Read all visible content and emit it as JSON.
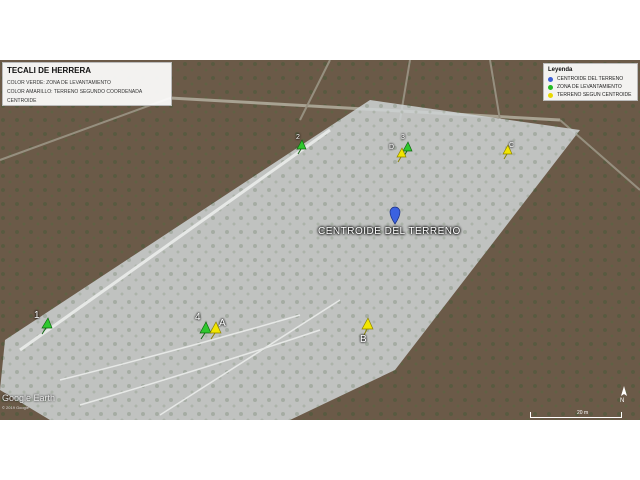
{
  "header": {
    "title": "TECALI DE HERRERA",
    "note_green": "COLOR VERDE: ZONA DE LEVANTAMIENTO",
    "note_yellow": "COLOR AMARILLO: TERRENO SEGUNDO COORDENADA CENTROIDE"
  },
  "legend": {
    "title": "Leyenda",
    "items": [
      {
        "label": "CENTROIDE DEL TERRENO",
        "color": "#3d5fd6"
      },
      {
        "label": "ZONA DE LEVANTAMIENTO",
        "color": "#22bb22"
      },
      {
        "label": "TERRENO SEGUN CENTROIDE",
        "color": "#e8d800"
      }
    ]
  },
  "map": {
    "center_label": "CENTROIDE DEL TERRENO",
    "pins": {
      "green_1": "1",
      "green_2": "2",
      "green_3": "3",
      "green_4": "4",
      "yellow_a": "A",
      "yellow_b": "B",
      "yellow_c": "C",
      "yellow_d": "D"
    },
    "attribution": "Google Earth",
    "image_credit": "© 2019 Google",
    "scale_label": "20 m",
    "north_label": "N"
  },
  "colors": {
    "green_pin": "#2ec82e",
    "yellow_pin": "#f2e600",
    "blue_pin": "#3b62e0",
    "terrain": "#6b5b45",
    "overlay": "#cfd4d4"
  }
}
